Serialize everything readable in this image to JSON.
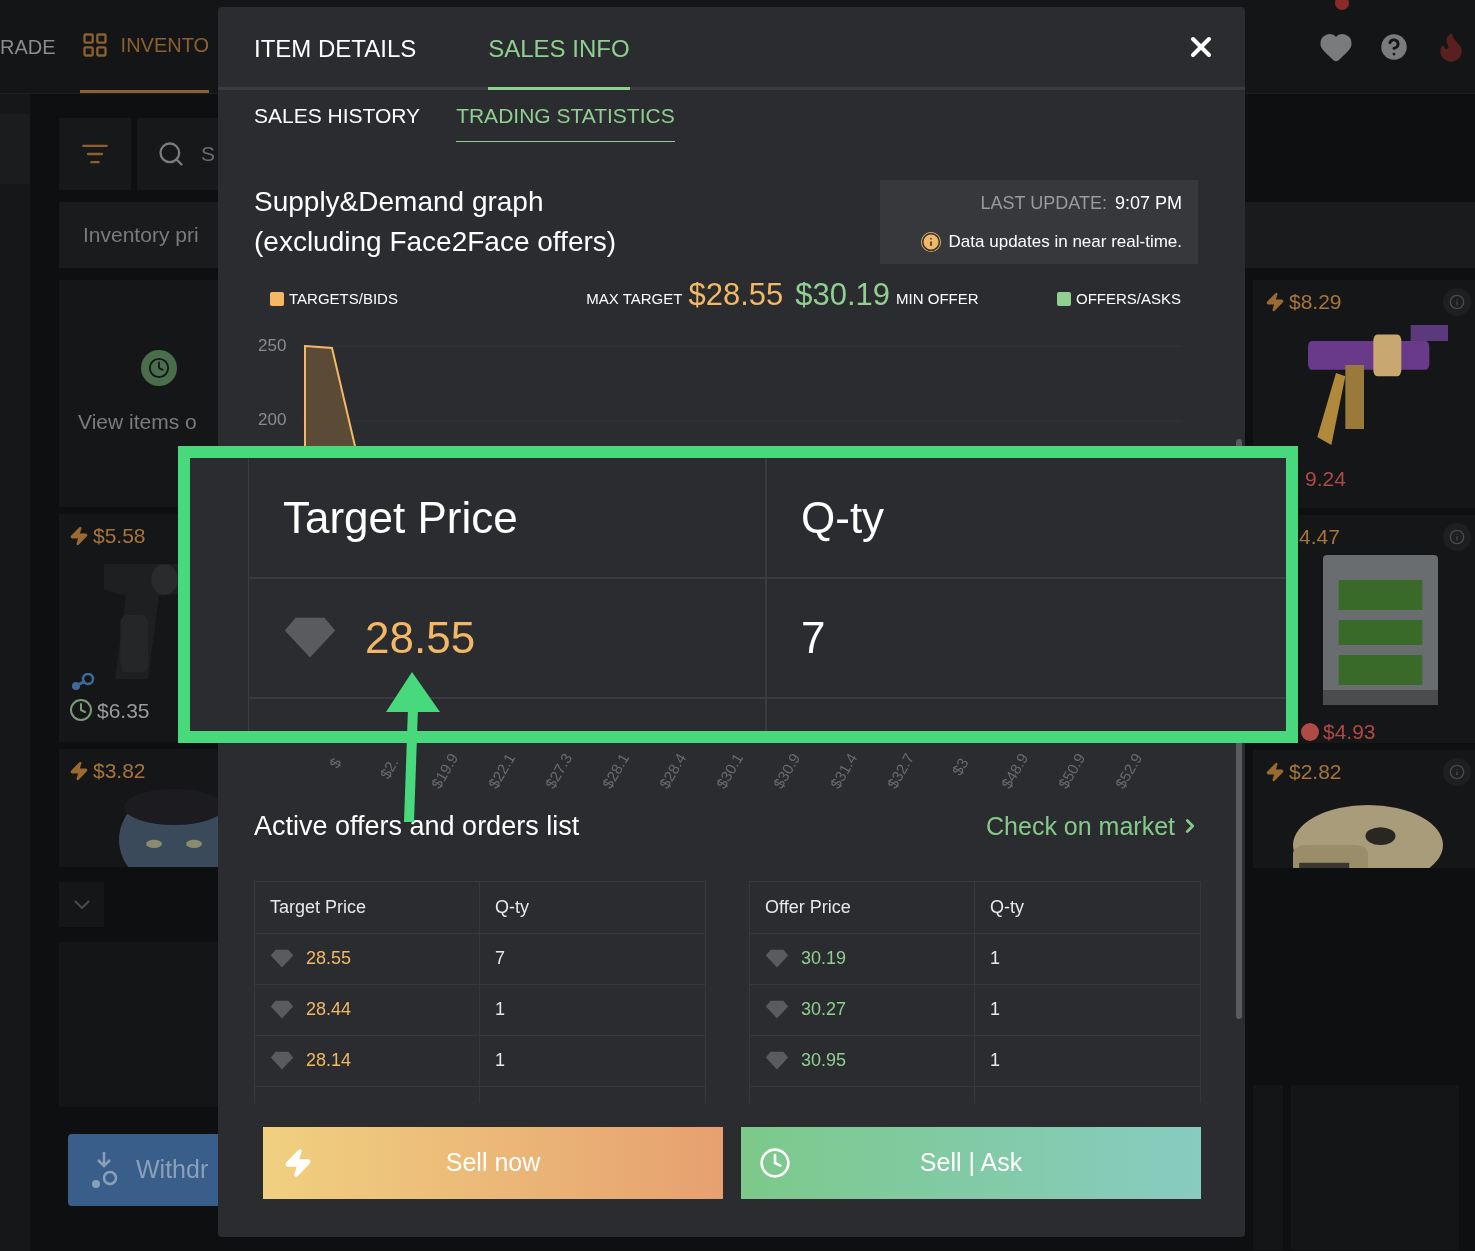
{
  "top_bar": {
    "nav": [
      {
        "label": "RADE",
        "selected": false
      },
      {
        "label": "INVENTO",
        "selected": true
      }
    ]
  },
  "background": {
    "search": {
      "placeholder": "S"
    },
    "inventory_bar": "Inventory pri",
    "left_cards": [
      {
        "kind": "info",
        "text": "View items o"
      },
      {
        "kind": "item",
        "instant_price": "$5.58",
        "listing": {
          "price": "$6.35",
          "color": "#7a9a78"
        }
      },
      {
        "kind": "item",
        "instant_price": "$3.82"
      }
    ],
    "withdraw_button": "Withdr",
    "right_cards": [
      {
        "instant_price": "$8.29",
        "listing": {
          "price": "9.24",
          "color": "#b04a44"
        }
      },
      {
        "instant_price": "4.47",
        "listing": {
          "price": "$4.93",
          "color": "#b04a44"
        }
      },
      {
        "instant_price": "$2.82"
      }
    ]
  },
  "modal": {
    "tabs": [
      {
        "label": "ITEM DETAILS",
        "selected": false
      },
      {
        "label": "SALES INFO",
        "selected": true
      }
    ],
    "subtabs": [
      {
        "label": "SALES HISTORY",
        "selected": false
      },
      {
        "label": "TRADING STATISTICS",
        "selected": true
      }
    ],
    "graph_title": "Supply&Demand graph",
    "graph_subtitle": "(excluding Face2Face offers)",
    "last_update": {
      "label": "LAST UPDATE:",
      "time": "9:07 PM",
      "note": "Data updates in near real-time."
    },
    "legend": {
      "bids": "TARGETS/BIDS",
      "max_target_label": "MAX TARGET",
      "max_target": "$28.55",
      "min_offer": "$30.19",
      "min_offer_label": "MIN OFFER",
      "asks": "OFFERS/ASKS"
    },
    "chart": {
      "y_ticks": [
        "250",
        "200"
      ],
      "x_labels": [
        "$",
        "$2.",
        "$19.9",
        "$22.1",
        "$27.3",
        "$28.1",
        "$28.4",
        "$30.1",
        "$30.9",
        "$31.4",
        "$32.7",
        "$3",
        "$48.9",
        "$50.9",
        "$52.9"
      ]
    },
    "orders": {
      "title": "Active offers and orders list",
      "market_link": "Check on market",
      "targets": {
        "columns": [
          "Target Price",
          "Q-ty"
        ],
        "rows": [
          {
            "price": "28.55",
            "qty": "7"
          },
          {
            "price": "28.44",
            "qty": "1"
          },
          {
            "price": "28.14",
            "qty": "1"
          }
        ]
      },
      "offers": {
        "columns": [
          "Offer Price",
          "Q-ty"
        ],
        "rows": [
          {
            "price": "30.19",
            "qty": "1"
          },
          {
            "price": "30.27",
            "qty": "1"
          },
          {
            "price": "30.95",
            "qty": "1"
          }
        ]
      }
    },
    "actions": [
      {
        "kind": "instant",
        "label": "Sell now"
      },
      {
        "kind": "ask",
        "label": "Sell | Ask"
      }
    ]
  },
  "zoom_callout": {
    "columns": [
      "Target Price",
      "Q-ty"
    ],
    "rows": [
      {
        "price": "28.55",
        "qty": "7"
      }
    ]
  }
}
